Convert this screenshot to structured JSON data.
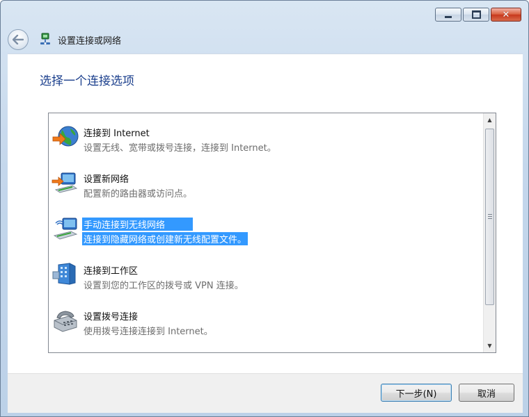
{
  "window": {
    "title_icon": "network-icon",
    "breadcrumb": "设置连接或网络",
    "controls": [
      "minimize-icon",
      "maximize-icon",
      "close-icon"
    ]
  },
  "page": {
    "heading": "选择一个连接选项"
  },
  "options": [
    {
      "title": "连接到 Internet",
      "description": "设置无线、宽带或拨号连接，连接到 Internet。",
      "icon": "globe-icon",
      "selected": false
    },
    {
      "title": "设置新网络",
      "description": "配置新的路由器或访问点。",
      "icon": "router-icon",
      "selected": false
    },
    {
      "title": "手动连接到无线网络",
      "description": "连接到隐藏网络或创建新无线配置文件。",
      "icon": "wireless-network-icon",
      "selected": true
    },
    {
      "title": "连接到工作区",
      "description": "设置到您的工作区的拨号或 VPN 连接。",
      "icon": "workplace-icon",
      "selected": false
    },
    {
      "title": "设置拨号连接",
      "description": "使用拨号连接连接到 Internet。",
      "icon": "phone-icon",
      "selected": false
    }
  ],
  "buttons": {
    "next": "下一步(N)",
    "cancel": "取消"
  },
  "colors": {
    "heading": "#1a3e8c",
    "selection": "#3399ff"
  }
}
